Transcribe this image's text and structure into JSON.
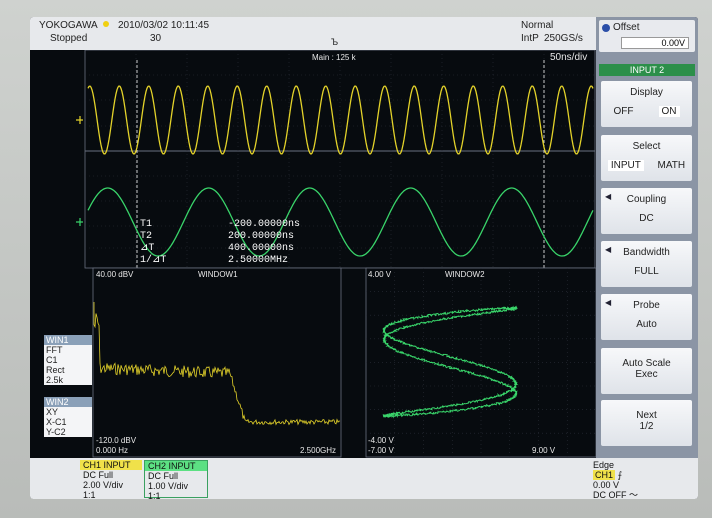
{
  "header": {
    "brand": "YOKOGAWA",
    "datetime": "2010/03/02 10:11:45",
    "status": "Stopped",
    "acq_count": "30",
    "trigger_mode": "Normal",
    "sample_mode": "IntP",
    "sample_rate": "250GS/s"
  },
  "main": {
    "title": "Main : 125 k",
    "timebase": "50ns/div"
  },
  "cursors": {
    "t1_label": "T1",
    "t1_value": "-200.00000ns",
    "t2_label": "T2",
    "t2_value": "200.00000ns",
    "dt_label": "⊿T",
    "dt_value": "400.00000ns",
    "inv_label": "1/⊿T",
    "inv_value": "2.50000MHz"
  },
  "window1": {
    "title": "WINDOW1",
    "top_label": "40.00 dBV",
    "bottom_label": "-120.0 dBV",
    "x_min": "0.000 Hz",
    "x_max": "2.500GHz"
  },
  "window2": {
    "title": "WINDOW2",
    "top_label": "4.00 V",
    "bottom_label": "-4.00 V",
    "x_min": "-7.00 V",
    "x_max": "9.00 V"
  },
  "win1_side": {
    "header": "WIN1",
    "lines": [
      "FFT",
      "C1",
      "Rect",
      "2.5k"
    ]
  },
  "win2_side": {
    "header": "WIN2",
    "lines": [
      "XY",
      "X-C1",
      "Y-C2"
    ]
  },
  "channels": [
    {
      "header": "CH1 INPUT",
      "coupling": "DC Full",
      "scale": "2.00 V/div",
      "probe": "1:1",
      "color": "#e3d22a"
    },
    {
      "header": "CH2 INPUT",
      "coupling": "DC Full",
      "scale": "1.00 V/div",
      "probe": "1:1",
      "color": "#39d46a"
    }
  ],
  "trigger": {
    "label": "Edge",
    "source": "CH1",
    "level": "0.00 V",
    "coupling": "DC OFF"
  },
  "offset": {
    "label": "Offset",
    "value": "0.00V"
  },
  "menu": {
    "title": "INPUT 2",
    "display": {
      "label": "Display",
      "off": "OFF",
      "on": "ON"
    },
    "select": {
      "label": "Select",
      "input": "INPUT",
      "math": "MATH"
    },
    "coupling": {
      "label": "Coupling",
      "value": "DC"
    },
    "bandwidth": {
      "label": "Bandwidth",
      "value": "FULL"
    },
    "probe": {
      "label": "Probe",
      "value": "Auto"
    },
    "autoscale": {
      "line1": "Auto Scale",
      "line2": "Exec"
    },
    "next": {
      "line1": "Next",
      "line2": "1/2"
    }
  },
  "colors": {
    "ch1": "#e3d22a",
    "ch2": "#39d46a",
    "grid": "#5a6070"
  },
  "icons": {
    "trigger_marker": "trigger-position-icon",
    "edge": "rising-edge-icon",
    "hf_reject": "hf-reject-icon"
  }
}
